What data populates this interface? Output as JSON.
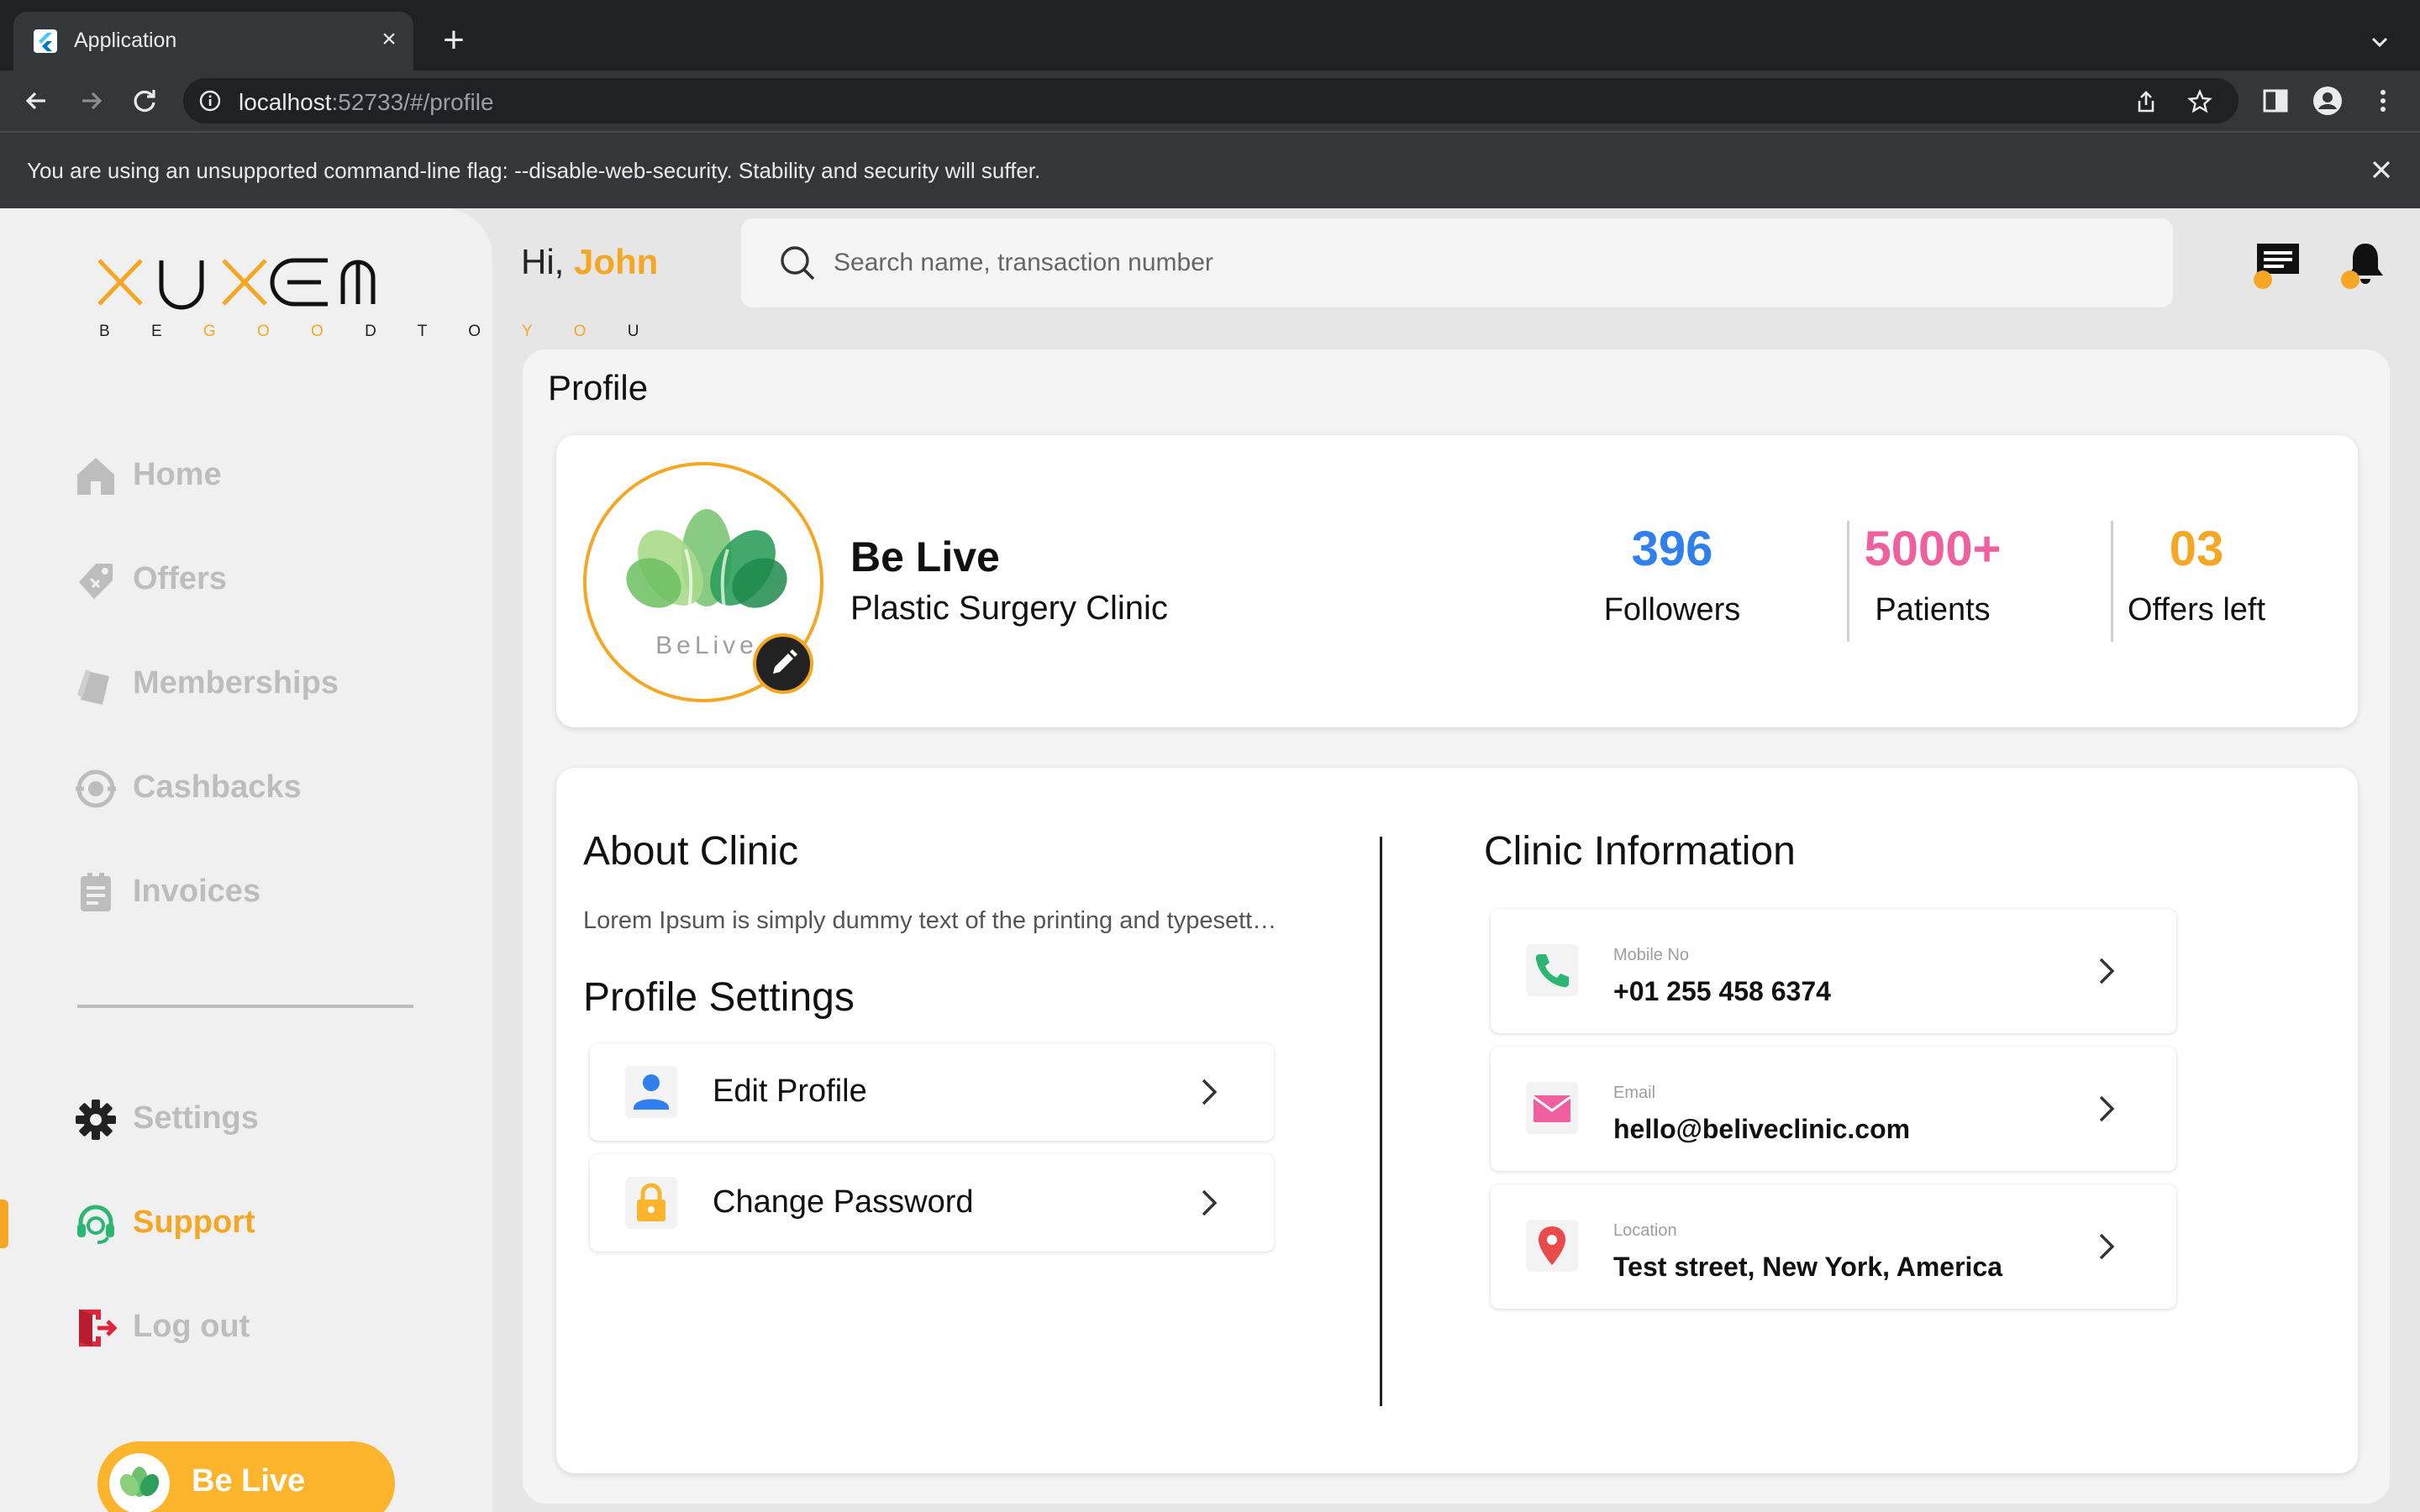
{
  "browser": {
    "tab_title": "Application",
    "url_host": "localhost",
    "url_rest": ":52733/#/profile",
    "infobar_message": "You are using an unsupported command-line flag: --disable-web-security. Stability and security will suffer."
  },
  "brand": {
    "accent": "#f5a623",
    "tagline_prefix": "B E  ",
    "tagline_go": "G O O",
    "tagline_mid": " D  T O  ",
    "tagline_yo": "Y O ",
    "tagline_u": "U"
  },
  "sidebar": {
    "items": [
      {
        "label": "Home",
        "icon": "home-icon"
      },
      {
        "label": "Offers",
        "icon": "tag-icon"
      },
      {
        "label": "Memberships",
        "icon": "card-icon"
      },
      {
        "label": "Cashbacks",
        "icon": "cashback-icon"
      },
      {
        "label": "Invoices",
        "icon": "invoice-icon"
      }
    ],
    "bottom_items": [
      {
        "label": "Settings",
        "icon": "gear-icon"
      },
      {
        "label": "Support",
        "icon": "headset-icon",
        "active": true
      },
      {
        "label": "Log out",
        "icon": "logout-icon"
      }
    ],
    "user_name": "Be Live"
  },
  "header": {
    "greeting": "Hi, ",
    "user": "John",
    "search_placeholder": "Search name, transaction number"
  },
  "profile": {
    "page_title": "Profile",
    "avatar_text": "BeLive",
    "clinic_name": "Be Live",
    "clinic_type": "Plastic Surgery Clinic",
    "stats": [
      {
        "value": "396",
        "label": "Followers",
        "color": "#2f80ed"
      },
      {
        "value": "5000+",
        "label": "Patients",
        "color": "#f0609e"
      },
      {
        "value": "03",
        "label": "Offers left",
        "color": "#f5a623"
      }
    ]
  },
  "about": {
    "title": "About Clinic",
    "text": "Lorem Ipsum is simply dummy text of the printing and typesetting industry."
  },
  "settings": {
    "title": "Profile Settings",
    "items": [
      {
        "label": "Edit Profile",
        "icon": "user-icon"
      },
      {
        "label": "Change Password",
        "icon": "lock-icon"
      }
    ]
  },
  "clinic_info": {
    "title": "Clinic Information",
    "items": [
      {
        "label": "Mobile No",
        "value": "+01 255 458 6374",
        "icon": "phone-icon"
      },
      {
        "label": "Email",
        "value": "hello@beliveclinic.com",
        "icon": "mail-icon"
      },
      {
        "label": "Location",
        "value": "Test street, New York, America",
        "icon": "location-pin-icon"
      }
    ]
  }
}
